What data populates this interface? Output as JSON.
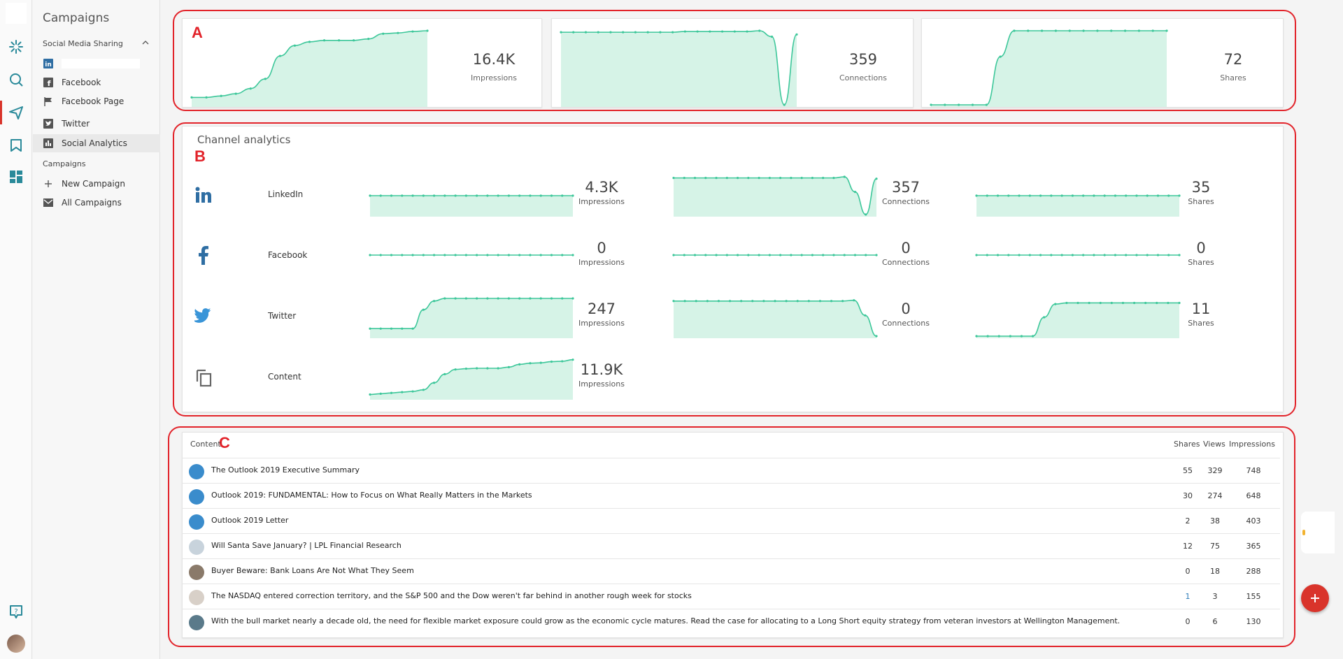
{
  "sidebar": {
    "title": "Campaigns",
    "section_social": "Social Media Sharing",
    "items": [
      {
        "label": "",
        "icon": "linkedin-icon"
      },
      {
        "label": "Facebook",
        "icon": "facebook-icon"
      },
      {
        "label": "Facebook Page",
        "icon": "flag-icon"
      },
      {
        "label": "Twitter",
        "icon": "twitter-icon"
      },
      {
        "label": "Social Analytics",
        "icon": "bar-chart-icon"
      }
    ],
    "section_campaigns": "Campaigns",
    "campaign_items": [
      {
        "label": "New Campaign",
        "icon": "plus-icon"
      },
      {
        "label": "All Campaigns",
        "icon": "mail-icon"
      }
    ]
  },
  "annotations": {
    "a": "A",
    "b": "B",
    "c": "C"
  },
  "summary": [
    {
      "value": "16.4K",
      "label": "Impressions",
      "series": [
        0.1,
        0.1,
        0.12,
        0.15,
        0.22,
        0.35,
        0.66,
        0.8,
        0.85,
        0.87,
        0.87,
        0.87,
        0.89,
        0.96,
        0.97,
        0.99,
        1.0
      ]
    },
    {
      "value": "359",
      "label": "Connections",
      "series": [
        0.98,
        0.98,
        0.98,
        0.98,
        0.98,
        0.98,
        0.98,
        0.98,
        0.98,
        0.98,
        0.99,
        0.99,
        0.99,
        0.99,
        0.99,
        0.99,
        1.0,
        0.92,
        0.0,
        0.95
      ]
    },
    {
      "value": "72",
      "label": "Shares",
      "series": [
        0.0,
        0.0,
        0.0,
        0.0,
        0.0,
        0.65,
        1.0,
        1.0,
        1.0,
        1.0,
        1.0,
        1.0,
        1.0,
        1.0,
        1.0,
        1.0,
        1.0,
        1.0
      ]
    }
  ],
  "channels": {
    "title": "Channel analytics",
    "rows": [
      {
        "name": "LinkedIn",
        "icon": "linkedin-icon",
        "metrics": [
          {
            "value": "4.3K",
            "label": "Impressions",
            "series": [
              0.5,
              0.5,
              0.5,
              0.5,
              0.5,
              0.5,
              0.5,
              0.5,
              0.5,
              0.5,
              0.5,
              0.5,
              0.5,
              0.5,
              0.5,
              0.5,
              0.5,
              0.5,
              0.5,
              0.5
            ]
          },
          {
            "value": "357",
            "label": "Connections",
            "series": [
              0.97,
              0.97,
              0.97,
              0.97,
              0.97,
              0.97,
              0.97,
              0.97,
              0.97,
              0.97,
              0.97,
              0.97,
              0.97,
              0.97,
              0.97,
              0.97,
              1.0,
              0.6,
              0.0,
              0.95
            ]
          },
          {
            "value": "35",
            "label": "Shares",
            "series": [
              0.5,
              0.5,
              0.5,
              0.5,
              0.5,
              0.5,
              0.5,
              0.5,
              0.5,
              0.5,
              0.5,
              0.5,
              0.5,
              0.5,
              0.5,
              0.5,
              0.5,
              0.5,
              0.5,
              0.5
            ]
          }
        ]
      },
      {
        "name": "Facebook",
        "icon": "facebook-icon",
        "metrics": [
          {
            "value": "0",
            "label": "Impressions",
            "series": [
              0.5,
              0.5,
              0.5,
              0.5,
              0.5,
              0.5,
              0.5,
              0.5,
              0.5,
              0.5,
              0.5,
              0.5,
              0.5,
              0.5,
              0.5,
              0.5,
              0.5,
              0.5,
              0.5,
              0.5
            ]
          },
          {
            "value": "0",
            "label": "Connections",
            "series": [
              0.5,
              0.5,
              0.5,
              0.5,
              0.5,
              0.5,
              0.5,
              0.5,
              0.5,
              0.5,
              0.5,
              0.5,
              0.5,
              0.5,
              0.5,
              0.5,
              0.5,
              0.5,
              0.5,
              0.5
            ]
          },
          {
            "value": "0",
            "label": "Shares",
            "series": [
              0.5,
              0.5,
              0.5,
              0.5,
              0.5,
              0.5,
              0.5,
              0.5,
              0.5,
              0.5,
              0.5,
              0.5,
              0.5,
              0.5,
              0.5,
              0.5,
              0.5,
              0.5,
              0.5,
              0.5
            ]
          }
        ]
      },
      {
        "name": "Twitter",
        "icon": "twitter-icon",
        "metrics": [
          {
            "value": "247",
            "label": "Impressions",
            "series": [
              0.2,
              0.2,
              0.2,
              0.2,
              0.2,
              0.7,
              0.93,
              1.0,
              1.0,
              1.0,
              1.0,
              1.0,
              1.0,
              1.0,
              1.0,
              1.0,
              1.0,
              1.0,
              1.0,
              1.0
            ]
          },
          {
            "value": "0",
            "label": "Connections",
            "series": [
              0.93,
              0.93,
              0.93,
              0.93,
              0.93,
              0.93,
              0.93,
              0.93,
              0.93,
              0.93,
              0.93,
              0.93,
              0.93,
              0.93,
              0.93,
              0.93,
              0.95,
              0.55,
              0.0
            ]
          },
          {
            "value": "11",
            "label": "Shares",
            "series": [
              0.0,
              0.0,
              0.0,
              0.0,
              0.0,
              0.0,
              0.5,
              0.85,
              0.88,
              0.88,
              0.88,
              0.88,
              0.88,
              0.88,
              0.88,
              0.88,
              0.88,
              0.88,
              0.88
            ]
          }
        ]
      },
      {
        "name": "Content",
        "icon": "copy-icon",
        "metrics": [
          {
            "value": "11.9K",
            "label": "Impressions",
            "series": [
              0.08,
              0.1,
              0.12,
              0.14,
              0.16,
              0.2,
              0.38,
              0.6,
              0.72,
              0.74,
              0.75,
              0.75,
              0.75,
              0.78,
              0.85,
              0.88,
              0.89,
              0.92,
              0.93,
              0.97
            ]
          }
        ]
      }
    ]
  },
  "content_table": {
    "headers": {
      "content": "Content",
      "shares": "Shares",
      "views": "Views",
      "impressions": "Impressions"
    },
    "rows": [
      {
        "title": "The Outlook 2019 Executive Summary",
        "shares": "55",
        "views": "329",
        "impressions": "748",
        "thumb": "#3a8ccc"
      },
      {
        "title": "Outlook 2019: FUNDAMENTAL: How to Focus on What Really Matters in the Markets",
        "shares": "30",
        "views": "274",
        "impressions": "648",
        "thumb": "#3a8ccc"
      },
      {
        "title": "Outlook 2019 Letter",
        "shares": "2",
        "views": "38",
        "impressions": "403",
        "thumb": "#3a8ccc"
      },
      {
        "title": "Will Santa Save January? | LPL Financial Research",
        "shares": "12",
        "views": "75",
        "impressions": "365",
        "thumb": "#c8d3dc"
      },
      {
        "title": "Buyer Beware: Bank Loans Are Not What They Seem",
        "shares": "0",
        "views": "18",
        "impressions": "288",
        "thumb": "#8a7a6a"
      },
      {
        "title": "The NASDAQ entered correction territory, and the S&P 500 and the Dow weren't far behind in another rough week for stocks",
        "shares": "1",
        "views": "3",
        "impressions": "155",
        "thumb": "#d8d0c8"
      },
      {
        "title": "With the bull market nearly a decade old, the need for flexible market exposure could grow as the economic cycle matures. Read the case for allocating to a Long Short equity strategy from veteran investors at Wellington Management.",
        "shares": "0",
        "views": "6",
        "impressions": "130",
        "thumb": "#5a7a8a"
      }
    ]
  },
  "colors": {
    "accent": "#2a8a9a",
    "spark_line": "#3dc79a",
    "spark_fill": "#d6f3e7",
    "outline": "#e2232a",
    "fab": "#d9342b"
  }
}
